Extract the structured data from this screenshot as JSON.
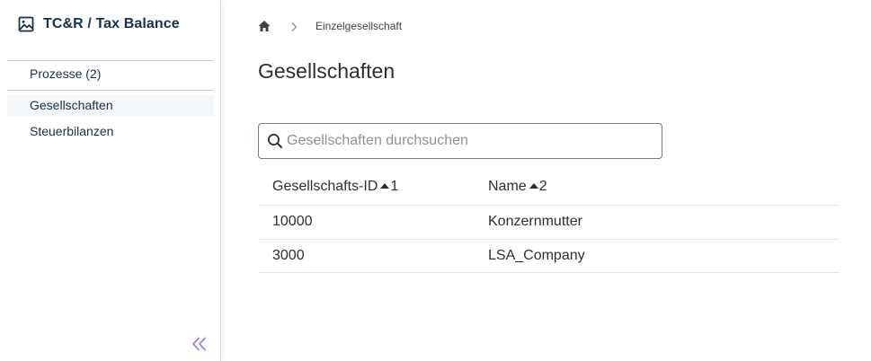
{
  "app": {
    "title": "TC&R / Tax Balance",
    "icon": "image-icon"
  },
  "sidebar": {
    "process_item": "Prozesse (2)",
    "items": [
      {
        "label": "Gesellschaften",
        "active": true
      },
      {
        "label": "Steuerbilanzen",
        "active": false
      }
    ],
    "collapse_icon": "double-chevron-left-icon",
    "accent_color": "#a77de6"
  },
  "breadcrumb": {
    "home_icon": "home-icon",
    "current": "Einzelgesellschaft"
  },
  "page": {
    "title": "Gesellschaften"
  },
  "search": {
    "placeholder": "Gesellschaften durchsuchen",
    "value": ""
  },
  "table": {
    "columns": [
      {
        "label": "Gesellschafts-ID",
        "sort_order": "1",
        "sort_direction": "ascending"
      },
      {
        "label": "Name",
        "sort_order": "2",
        "sort_direction": "ascending"
      }
    ],
    "rows": [
      {
        "id": "10000",
        "name": "Konzernmutter"
      },
      {
        "id": "3000",
        "name": "LSA_Company"
      }
    ]
  }
}
